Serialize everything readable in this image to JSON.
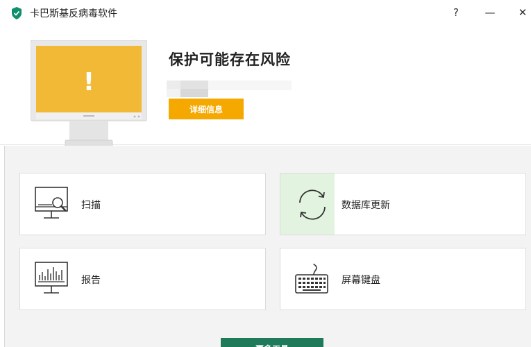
{
  "window": {
    "title": "卡巴斯基反病毒软件",
    "help": "?",
    "minimize": "—",
    "close": "✕"
  },
  "status": {
    "title": "保护可能存在风险",
    "details_button": "详细信息",
    "monitor_symbol": "!"
  },
  "tiles": [
    {
      "label": "扫描",
      "icon": "scan-monitor-icon"
    },
    {
      "label": "数据库更新",
      "icon": "refresh-icon"
    },
    {
      "label": "报告",
      "icon": "report-chart-icon"
    },
    {
      "label": "屏幕键盘",
      "icon": "keyboard-icon"
    }
  ],
  "more_tools": "更多工具",
  "colors": {
    "warning": "#f5a800",
    "monitor_screen": "#f2b936",
    "accent_green": "#1f7a5a",
    "highlight_green": "#e2f4e0"
  }
}
